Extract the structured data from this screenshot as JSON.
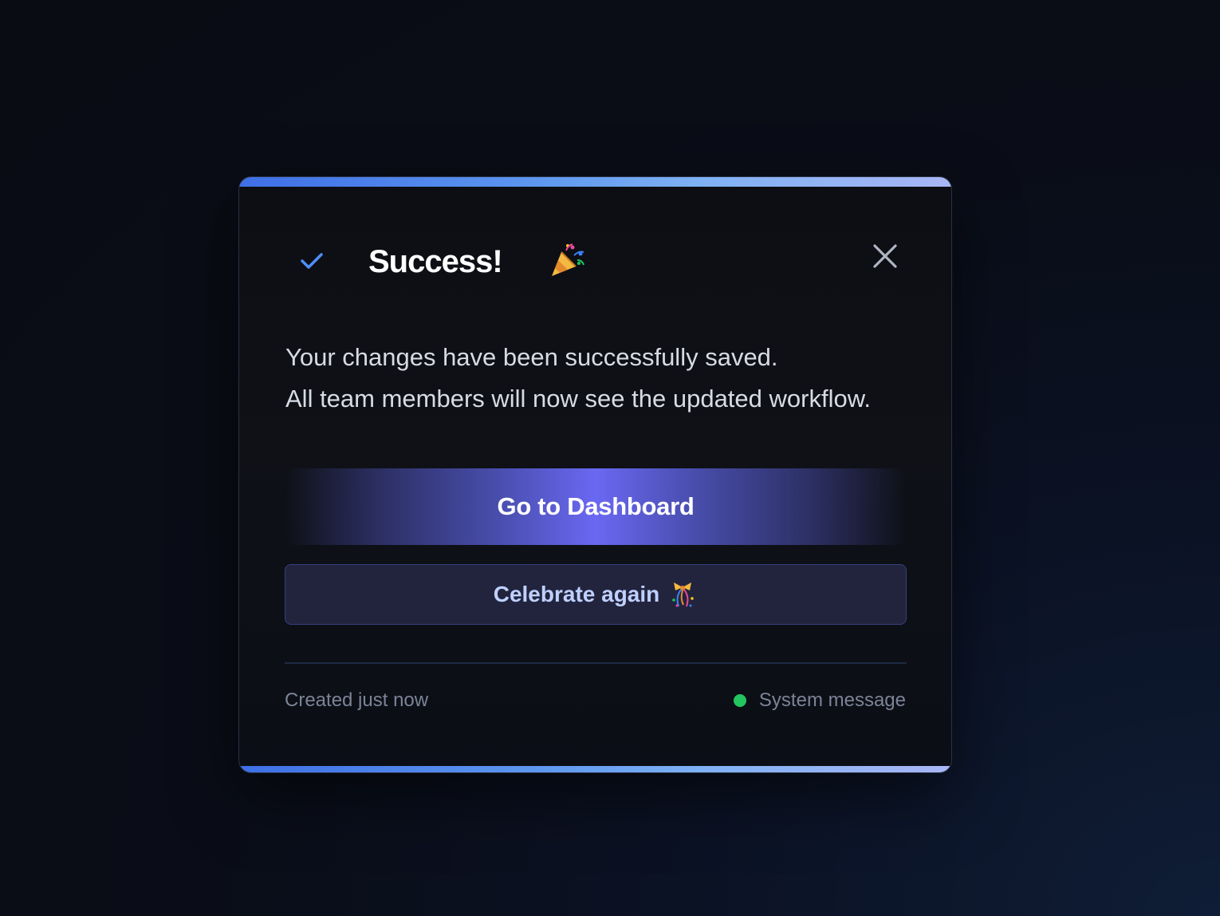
{
  "dialog": {
    "title": "Success!",
    "title_icon": "party-popper-icon",
    "status_icon": "check-icon",
    "close_icon": "close-icon",
    "message_line1": "Your changes have been successfully saved.",
    "message_line2": "All team members will now see the updated workflow.",
    "primary_button_label": "Go to Dashboard",
    "secondary_button_label": "Celebrate again",
    "secondary_button_icon": "confetti-ribbon-icon",
    "footer_left": "Created just now",
    "footer_right": "System message",
    "status_color": "#22c55e",
    "accent_color": "#6366f1"
  }
}
